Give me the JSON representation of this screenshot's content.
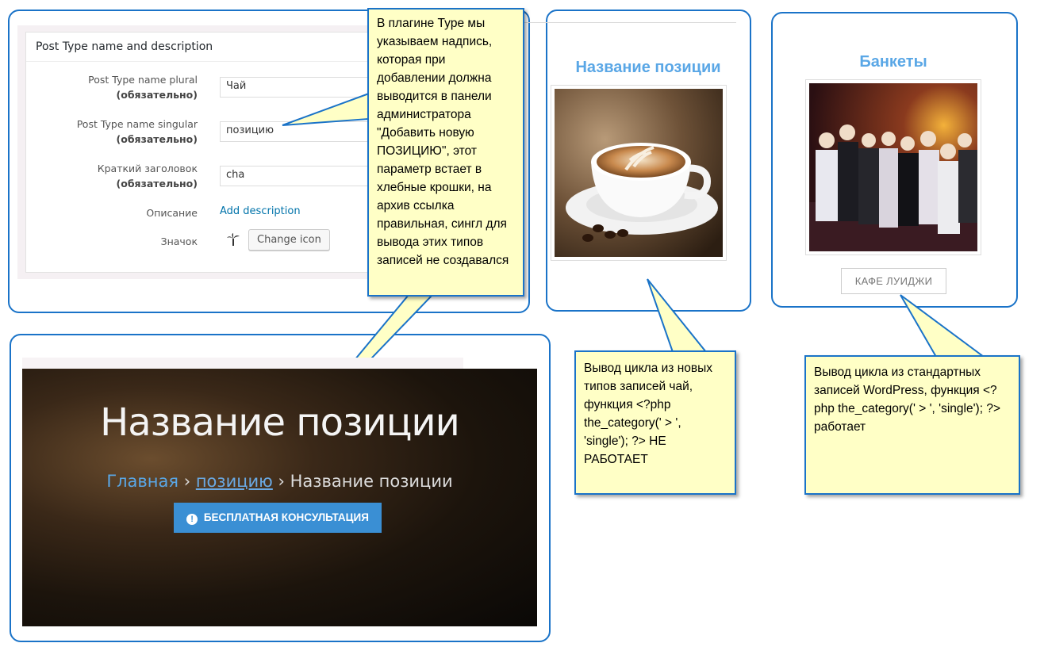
{
  "wp_settings": {
    "title": "Post Type name and description",
    "fields": [
      {
        "label": "Post Type name plural",
        "required": "(обязательно)",
        "value": "Чай"
      },
      {
        "label": "Post Type name singular",
        "required": "(обязательно)",
        "value": "позицию"
      },
      {
        "label": "Краткий заголовок",
        "required": "(обязательно)",
        "value": "cha"
      }
    ],
    "description_label": "Описание",
    "description_link": "Add description",
    "icon_label": "Значок",
    "change_icon_button": "Change icon"
  },
  "callout_main": "В плагине Type мы указываем надпись, которая при добавлении должна выводится в панели администратора \"Добавить новую ПОЗИЦИЮ\", этот параметр встает в хлебные крошки, на архив ссылка правильная, сингл для вывода этих типов записей не создавался",
  "product_card": {
    "title": "Название позиции"
  },
  "banquet_card": {
    "title": "Банкеты",
    "button": "КАФЕ ЛУИДЖИ"
  },
  "callout_new_types": "Вывод цикла из новых типов записей чай, функция <?php the_category(' > ', 'single'); ?> НЕ РАБОТАЕТ",
  "callout_standard": "Вывод цикла из стандартных записей WordPress, функция <?php the_category(' > ', 'single'); ?> работает",
  "hero": {
    "title": "Название позиции",
    "crumb_home": "Главная",
    "crumb_sep1": "›",
    "crumb_category": "позицию",
    "crumb_sep2": "›",
    "crumb_current": "Название позиции",
    "button": "БЕСПЛАТНАЯ КОНСУЛЬТАЦИЯ",
    "button_icon": "!"
  },
  "colors": {
    "frame": "#1a73c8",
    "callout_bg": "#ffffc6",
    "title_blue": "#5aa7e6",
    "button_blue": "#3a8fd4"
  }
}
